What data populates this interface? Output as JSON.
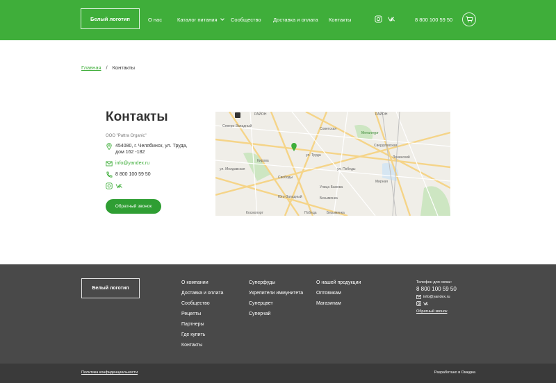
{
  "header": {
    "logo": "Белый логотип",
    "nav": [
      "О нас",
      "Каталог питания",
      "Сообщество",
      "Доставка и оплата",
      "Контакты"
    ],
    "phone": "8 800 100 59 50"
  },
  "breadcrumb": {
    "home": "Главная",
    "separator": "/",
    "current": "Контакты"
  },
  "contacts": {
    "title": "Контакты",
    "company": "ООО \"Pattra Organic\"",
    "address_line1": "454080, г. Челябинск, ул. Труда,",
    "address_line2": "дом 162 -182",
    "email": "info@yandex.ru",
    "phone": "8 800 100 59 50",
    "callback_button": "Обратный звонок"
  },
  "map": {
    "labels": [
      "РАЙОН",
      "РАЙОН",
      "Металлург",
      "Северо-Западный",
      "Свердловская",
      "Советская",
      "ул. Труда",
      "Кирова",
      "Свободы",
      "ул. Молдавская",
      "Улица Бажова",
      "ул. Победы",
      "Ленинский",
      "Юго-Западный",
      "Безымянка",
      "Мирная",
      "Космопорт",
      "Безымянка",
      "Победа"
    ]
  },
  "footer": {
    "logo": "Белый логотип",
    "col1": [
      "О компании",
      "Доставка и оплата",
      "Сообщество",
      "Рецепты",
      "Партнеры",
      "Где купить",
      "Контакты"
    ],
    "col2": [
      "Суперфуды",
      "Укрепители иммунитета",
      "Суперцвет",
      "Суперчай"
    ],
    "col3": [
      "О нашей продукции",
      "Оптовикам",
      "Магазинам"
    ],
    "phone_label": "Телефон для связи:",
    "phone": "8 800 100 59 50",
    "email": "info@yandex.ru",
    "callback": "Обратный звонок"
  },
  "bottom": {
    "privacy": "Политика конфиденциальности",
    "made_by": "Разработано в Омедиа"
  },
  "colors": {
    "brand_green": "#3fae3a",
    "footer_bg": "#494949"
  }
}
